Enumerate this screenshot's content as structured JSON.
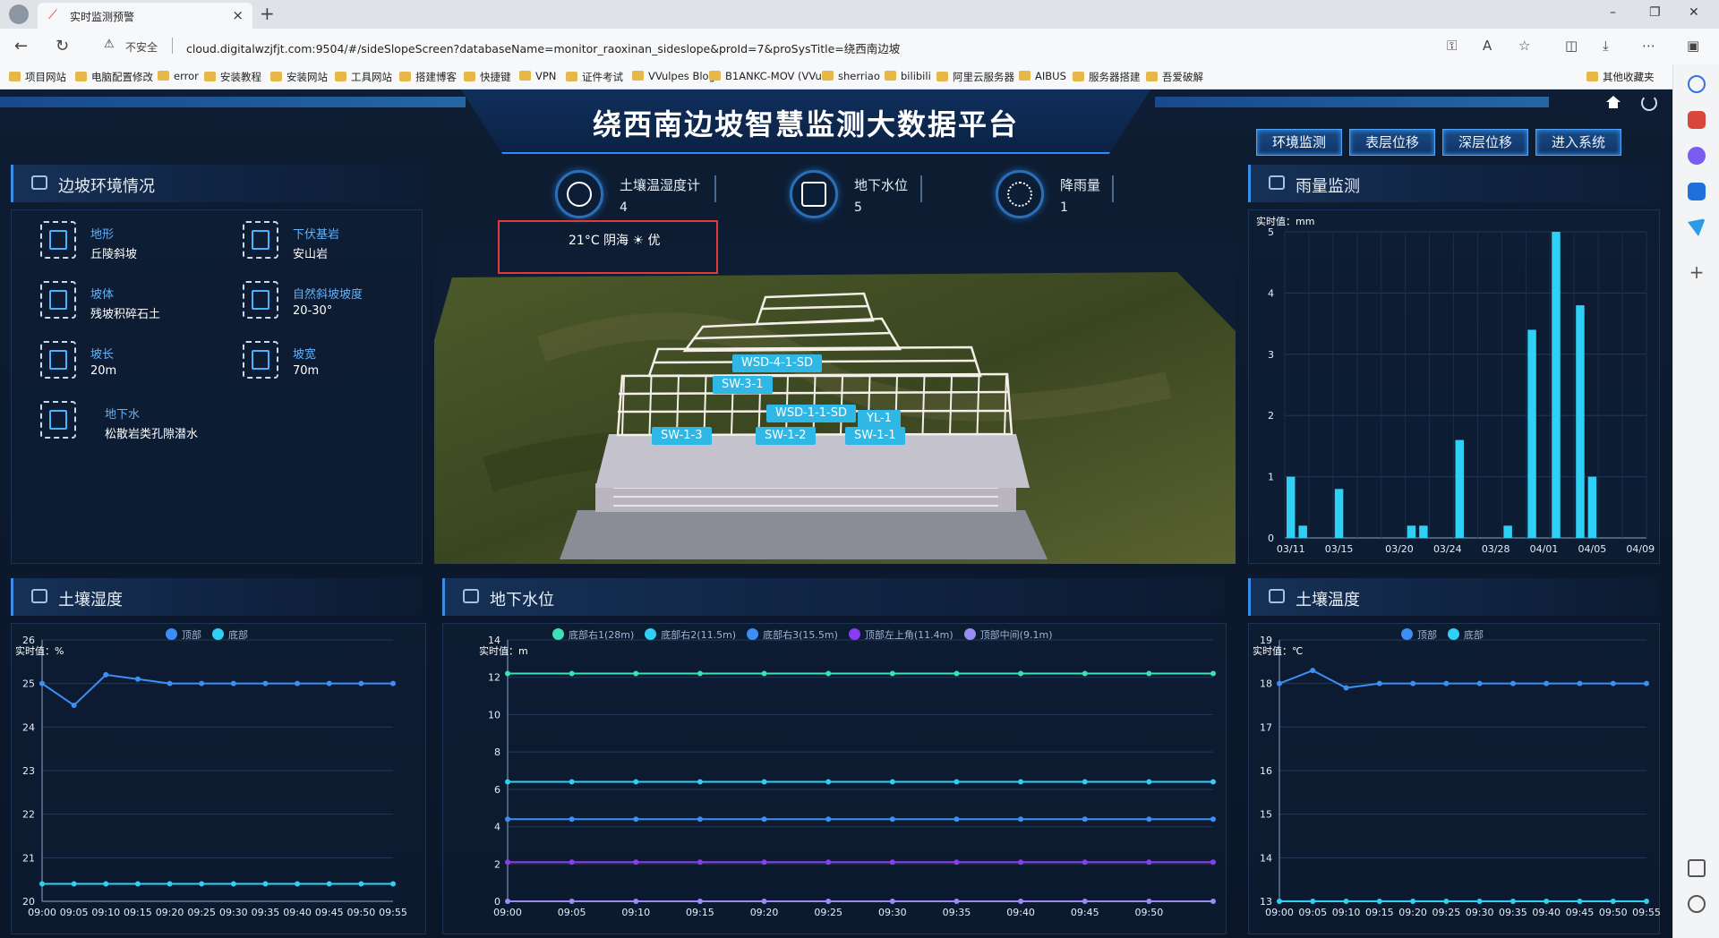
{
  "browser": {
    "tab_title": "实时监测预警",
    "new_tab": "+",
    "close_tab": "×",
    "minimize": "–",
    "restore": "❐",
    "close": "✕",
    "not_secure": "不安全",
    "url": "cloud.digitalwzjfjt.com:9504/#/sideSlopeScreen?databaseName=monitor_raoxinan_sideslope&proId=7&proSysTitle=绕西南边坡",
    "bookmarks": [
      "项目网站",
      "电脑配置修改",
      "error",
      "安装教程",
      "安装网站",
      "工具网站",
      "搭建博客",
      "快捷键",
      "VPN",
      "证件考试",
      "VVulpes Blog",
      "B1ANKC-MOV (VVu...",
      "sherriao",
      "bilibili",
      "阿里云服务器",
      "AIBUS",
      "服务器搭建",
      "吾爱破解",
      "其他收藏夹"
    ]
  },
  "header": {
    "title": "绕西南边坡智慧监测大数据平台",
    "nav": [
      "环境监测",
      "表层位移",
      "深层位移",
      "进入系统"
    ]
  },
  "env": {
    "title": "边坡环境情况",
    "items": [
      {
        "label": "地形",
        "value": "丘陵斜坡"
      },
      {
        "label": "下伏基岩",
        "value": "安山岩"
      },
      {
        "label": "坡体",
        "value": "残坡积碎石土"
      },
      {
        "label": "自然斜坡坡度",
        "value": "20-30°"
      },
      {
        "label": "坡长",
        "value": "20m"
      },
      {
        "label": "坡宽",
        "value": "70m"
      },
      {
        "label": "地下水",
        "value": "松散岩类孔隙潜水"
      }
    ]
  },
  "sensors": [
    {
      "label": "土壤温湿度计",
      "value": "4"
    },
    {
      "label": "地下水位",
      "value": "5"
    },
    {
      "label": "降雨量",
      "value": "1"
    }
  ],
  "weather": "21°C 阴海  ☀  优",
  "markers": [
    "WSD-4-1-SD",
    "SW-3-1",
    "WSD-1-1-SD",
    "YL-1",
    "SW-1-3",
    "SW-1-2",
    "SW-1-1"
  ],
  "rain": {
    "title": "雨量监测",
    "unit": "实时值：mm"
  },
  "soil_humidity": {
    "title": "土壤湿度",
    "unit": "实时值：%"
  },
  "groundwater": {
    "title": "地下水位",
    "unit": "实时值：m"
  },
  "soil_temp": {
    "title": "土壤温度",
    "unit": "实时值：℃"
  },
  "chart_data": [
    {
      "type": "bar",
      "title": "雨量监测",
      "x": [
        "03/11",
        "03/12",
        "03/13",
        "03/14",
        "03/15",
        "03/16",
        "03/17",
        "03/18",
        "03/19",
        "03/20",
        "03/21",
        "03/22",
        "03/23",
        "03/24",
        "03/25",
        "03/26",
        "03/27",
        "03/28",
        "03/29",
        "03/30",
        "03/31",
        "04/01",
        "04/02",
        "04/03",
        "04/04",
        "04/05",
        "04/06",
        "04/07",
        "04/08",
        "04/09"
      ],
      "xticks": [
        "03/11",
        "03/15",
        "03/20",
        "03/24",
        "03/28",
        "04/01",
        "04/05",
        "04/09"
      ],
      "values": [
        1.0,
        0.2,
        0,
        0,
        0.8,
        0,
        0,
        0,
        0,
        0,
        0.2,
        0.2,
        0,
        0,
        1.6,
        0,
        0,
        0,
        0.2,
        0,
        3.4,
        0,
        5.0,
        0,
        3.8,
        1.0,
        0,
        0,
        0,
        0
      ],
      "ylim": [
        0,
        5
      ],
      "yticks": [
        0,
        1,
        2,
        3,
        4,
        5
      ],
      "color": "#2fd0f5"
    },
    {
      "type": "line",
      "title": "土壤湿度",
      "x": [
        "09:00",
        "09:05",
        "09:10",
        "09:15",
        "09:20",
        "09:25",
        "09:30",
        "09:35",
        "09:40",
        "09:45",
        "09:50",
        "09:55"
      ],
      "ylim": [
        20,
        26
      ],
      "yticks": [
        20,
        21,
        22,
        23,
        24,
        25,
        26
      ],
      "series": [
        {
          "name": "顶部",
          "color": "#3b8ff5",
          "values": [
            25.0,
            24.5,
            25.2,
            25.1,
            25.0,
            25.0,
            25.0,
            25.0,
            25.0,
            25.0,
            25.0,
            25.0
          ]
        },
        {
          "name": "底部",
          "color": "#2fd0f5",
          "values": [
            20.4,
            20.4,
            20.4,
            20.4,
            20.4,
            20.4,
            20.4,
            20.4,
            20.4,
            20.4,
            20.4,
            20.4
          ]
        }
      ]
    },
    {
      "type": "line",
      "title": "地下水位",
      "x": [
        "09:00",
        "09:05",
        "09:10",
        "09:15",
        "09:20",
        "09:25",
        "09:30",
        "09:35",
        "09:40",
        "09:45",
        "09:50",
        "09:55"
      ],
      "xticks": [
        "09:00",
        "09:05",
        "09:10",
        "09:15",
        "09:20",
        "09:25",
        "09:30",
        "09:35",
        "09:40",
        "09:45",
        "09:50"
      ],
      "ylim": [
        0,
        14
      ],
      "yticks": [
        0,
        2,
        4,
        6,
        8,
        10,
        12,
        14
      ],
      "series": [
        {
          "name": "底部右1(28m)",
          "color": "#3ee0b6",
          "values": [
            12.2,
            12.2,
            12.2,
            12.2,
            12.2,
            12.2,
            12.2,
            12.2,
            12.2,
            12.2,
            12.2,
            12.2
          ]
        },
        {
          "name": "底部右2(11.5m)",
          "color": "#2fd0f5",
          "values": [
            6.4,
            6.4,
            6.4,
            6.4,
            6.4,
            6.4,
            6.4,
            6.4,
            6.4,
            6.4,
            6.4,
            6.4
          ]
        },
        {
          "name": "底部右3(15.5m)",
          "color": "#3b8ff5",
          "values": [
            4.4,
            4.4,
            4.4,
            4.4,
            4.4,
            4.4,
            4.4,
            4.4,
            4.4,
            4.4,
            4.4,
            4.4
          ]
        },
        {
          "name": "顶部左上角(11.4m)",
          "color": "#8b3cf0",
          "values": [
            2.1,
            2.1,
            2.1,
            2.1,
            2.1,
            2.1,
            2.1,
            2.1,
            2.1,
            2.1,
            2.1,
            2.1
          ]
        },
        {
          "name": "顶部中间(9.1m)",
          "color": "#9b8cf5",
          "values": [
            0.0,
            0.0,
            0.0,
            0.0,
            0.0,
            0.0,
            0.0,
            0.0,
            0.0,
            0.0,
            0.0,
            0.0
          ]
        }
      ]
    },
    {
      "type": "line",
      "title": "土壤温度",
      "x": [
        "09:00",
        "09:05",
        "09:10",
        "09:15",
        "09:20",
        "09:25",
        "09:30",
        "09:35",
        "09:40",
        "09:45",
        "09:50",
        "09:55"
      ],
      "ylim": [
        13,
        19
      ],
      "yticks": [
        13,
        14,
        15,
        16,
        17,
        18,
        19
      ],
      "series": [
        {
          "name": "顶部",
          "color": "#3b8ff5",
          "values": [
            18.0,
            18.3,
            17.9,
            18.0,
            18.0,
            18.0,
            18.0,
            18.0,
            18.0,
            18.0,
            18.0,
            18.0
          ]
        },
        {
          "name": "底部",
          "color": "#2fd0f5",
          "values": [
            13.0,
            13.0,
            13.0,
            13.0,
            13.0,
            13.0,
            13.0,
            13.0,
            13.0,
            13.0,
            13.0,
            13.0
          ]
        }
      ]
    }
  ]
}
